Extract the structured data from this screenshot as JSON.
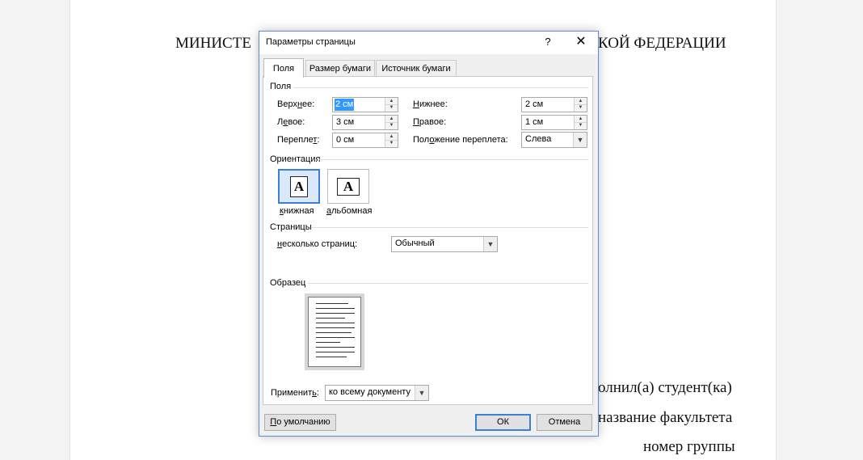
{
  "document": {
    "lines": [
      "МИНИСТЕ",
      "КОЙ ФЕДЕРАЦИИ",
      "олнил(а) студент(ка)",
      "название факультета",
      "номер группы"
    ]
  },
  "dialog": {
    "title": "Параметры страницы",
    "help": "?",
    "close": "✕",
    "tabs": [
      "Поля",
      "Размер бумаги",
      "Источник бумаги"
    ],
    "margins_section": "Поля",
    "fields": {
      "top": {
        "label_pre": "Верх",
        "label_u": "н",
        "label_post": "ее:",
        "value": "2 см"
      },
      "bottom": {
        "label_pre": "",
        "label_u": "Н",
        "label_post": "ижнее:",
        "value": "2 см"
      },
      "left": {
        "label_pre": "Л",
        "label_u": "е",
        "label_post": "вое:",
        "value": "3 см"
      },
      "right": {
        "label_pre": "",
        "label_u": "П",
        "label_post": "равое:",
        "value": "1 см"
      },
      "gutter": {
        "label_pre": "Перепле",
        "label_u": "т",
        "label_post": ":",
        "value": "0 см"
      },
      "gutter_pos": {
        "label_pre": "Пол",
        "label_u": "о",
        "label_post": "жение переплета:",
        "value": "Слева"
      }
    },
    "orientation_section": "Ориентация",
    "orientation": {
      "portrait_pre": "",
      "portrait_u": "к",
      "portrait_post": "нижная",
      "landscape_pre": "",
      "landscape_u": "а",
      "landscape_post": "льбомная",
      "icon_letter": "A"
    },
    "pages_section": "Страницы",
    "pages": {
      "label_pre": "",
      "label_u": "н",
      "label_post": "есколько страниц:",
      "value": "Обычный"
    },
    "sample_section": "Образец",
    "apply": {
      "label_pre": "Применит",
      "label_u": "ь",
      "label_post": ":",
      "value": "ко всему документу"
    },
    "buttons": {
      "default_pre": "",
      "default_u": "П",
      "default_post": "о умолчанию",
      "ok": "ОК",
      "cancel": "Отмена"
    }
  }
}
